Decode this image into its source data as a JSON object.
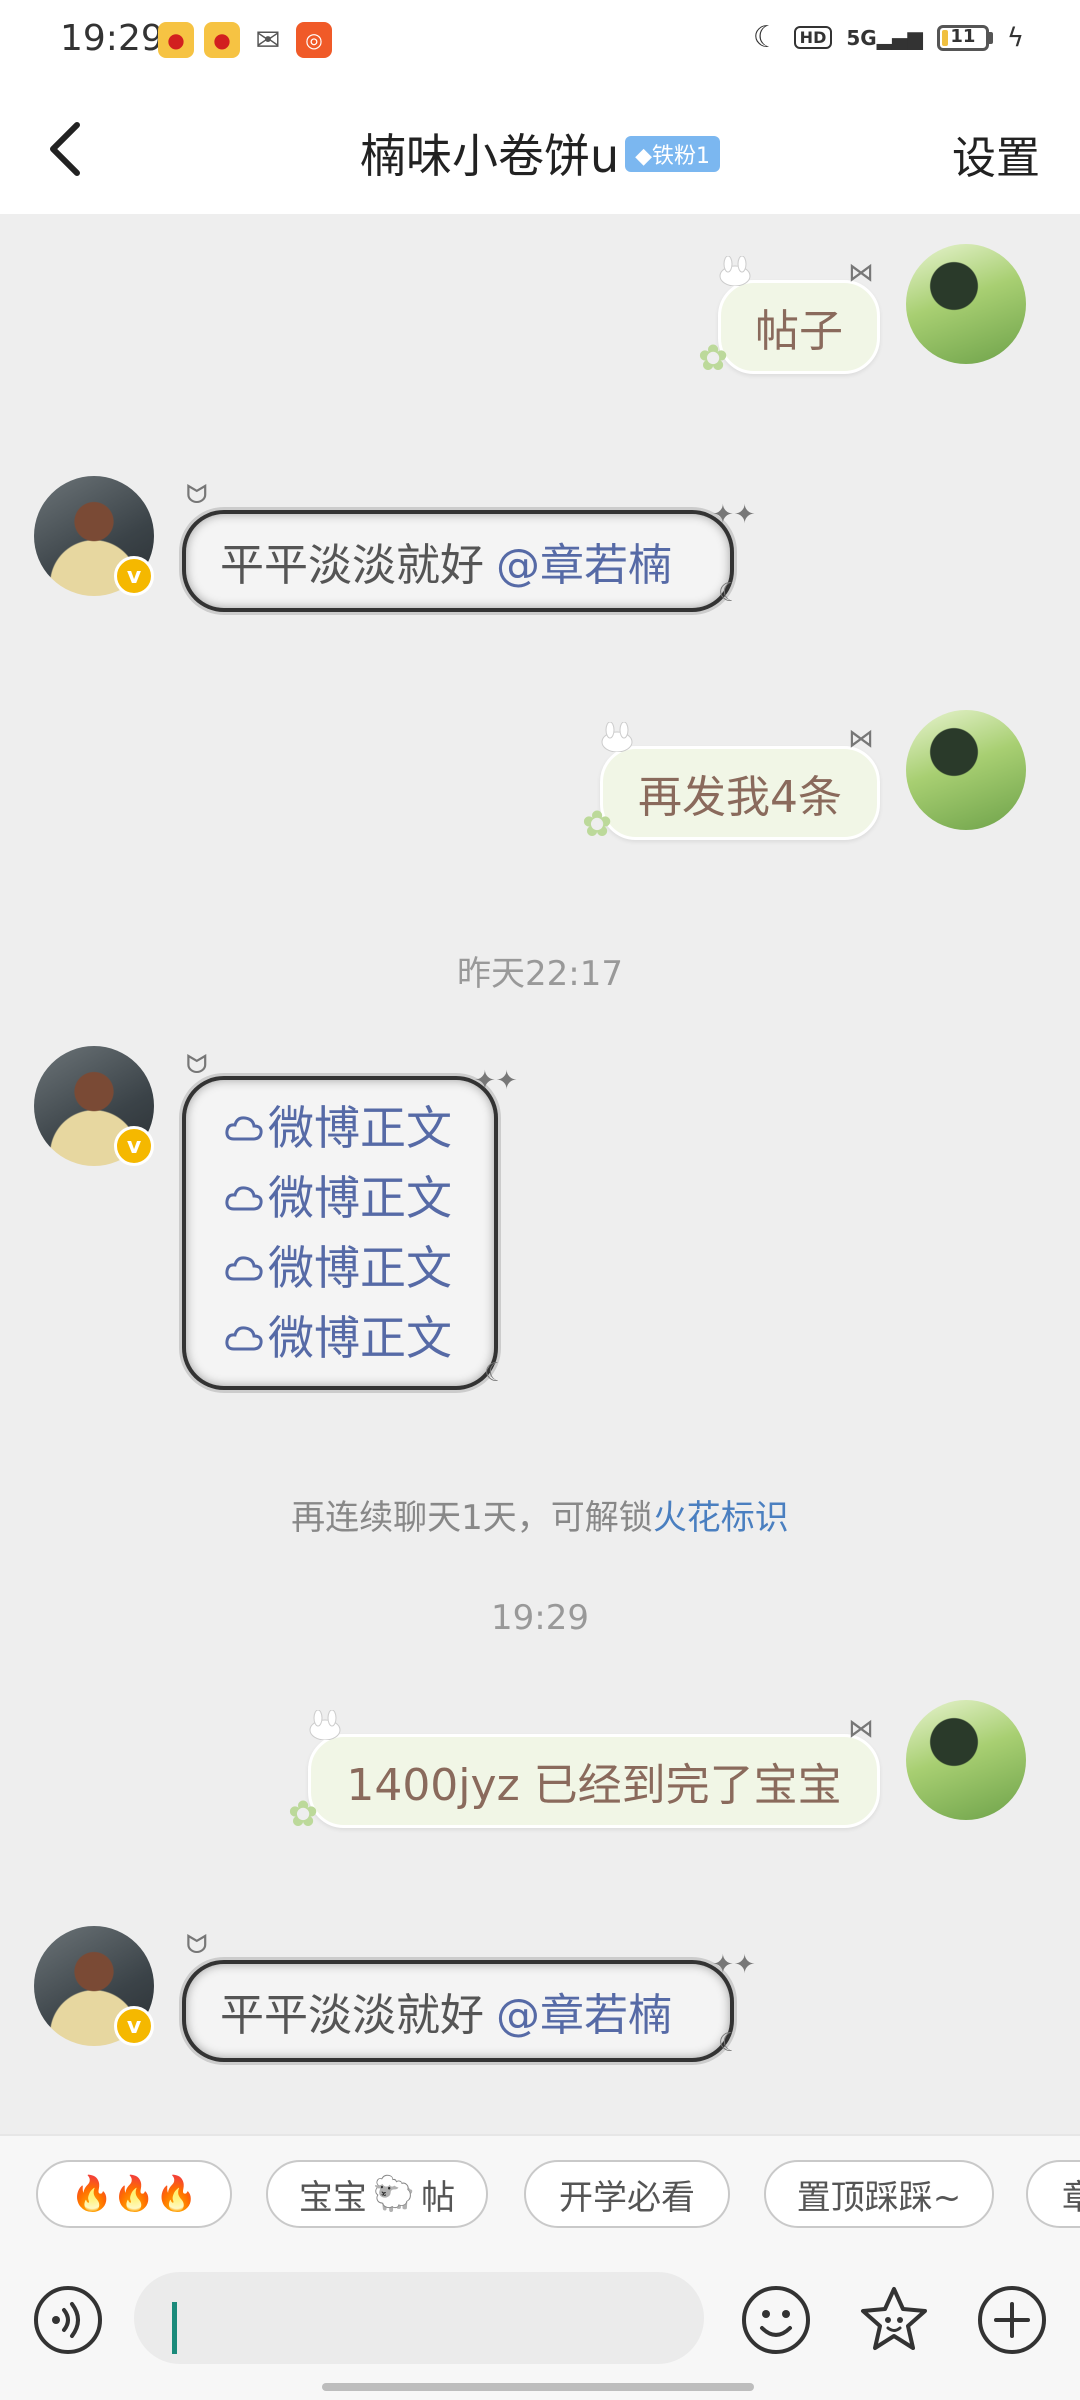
{
  "status_bar": {
    "time": "19:29",
    "network": "5G",
    "battery": "11",
    "battery_level": 0.11
  },
  "header": {
    "title": "楠味小卷饼u",
    "fan_badge": "铁粉1",
    "settings_label": "设置"
  },
  "messages": [
    {
      "from": "me",
      "text": "帖子"
    },
    {
      "from": "other",
      "text": "平平淡淡就好",
      "mention": "@章若楠"
    },
    {
      "from": "me",
      "text": "再发我4条"
    },
    {
      "from": "other",
      "lines": [
        "微博正文",
        "微博正文",
        "微博正文",
        "微博正文"
      ]
    },
    {
      "from": "me",
      "text": "1400jyz 已经到完了宝宝"
    },
    {
      "from": "other",
      "text": "平平淡淡就好",
      "mention": "@章若楠"
    }
  ],
  "timestamps": [
    "昨天22:17",
    "19:29"
  ],
  "system_message": {
    "text": "再连续聊天1天，可解锁",
    "link": "火花标识"
  },
  "quick_replies": [
    "🔥🔥🔥",
    "宝宝",
    "帖",
    "开学必看",
    "置顶踩踩~",
    "章"
  ],
  "input": {
    "placeholder": ""
  },
  "icons": [
    "back-icon",
    "voice-icon",
    "emoji-icon",
    "sticker-icon",
    "plus-icon",
    "cloud-icon",
    "moon-icon",
    "sparkle-icon",
    "butterfly-icon",
    "bow-icon",
    "clover-icon",
    "bunny-icon",
    "verified-icon",
    "diamond-icon",
    "sheep-icon"
  ],
  "colors": {
    "accent": "#4a7fc0",
    "my_bubble": "#f1f6e6",
    "mention": "#566aa6"
  }
}
